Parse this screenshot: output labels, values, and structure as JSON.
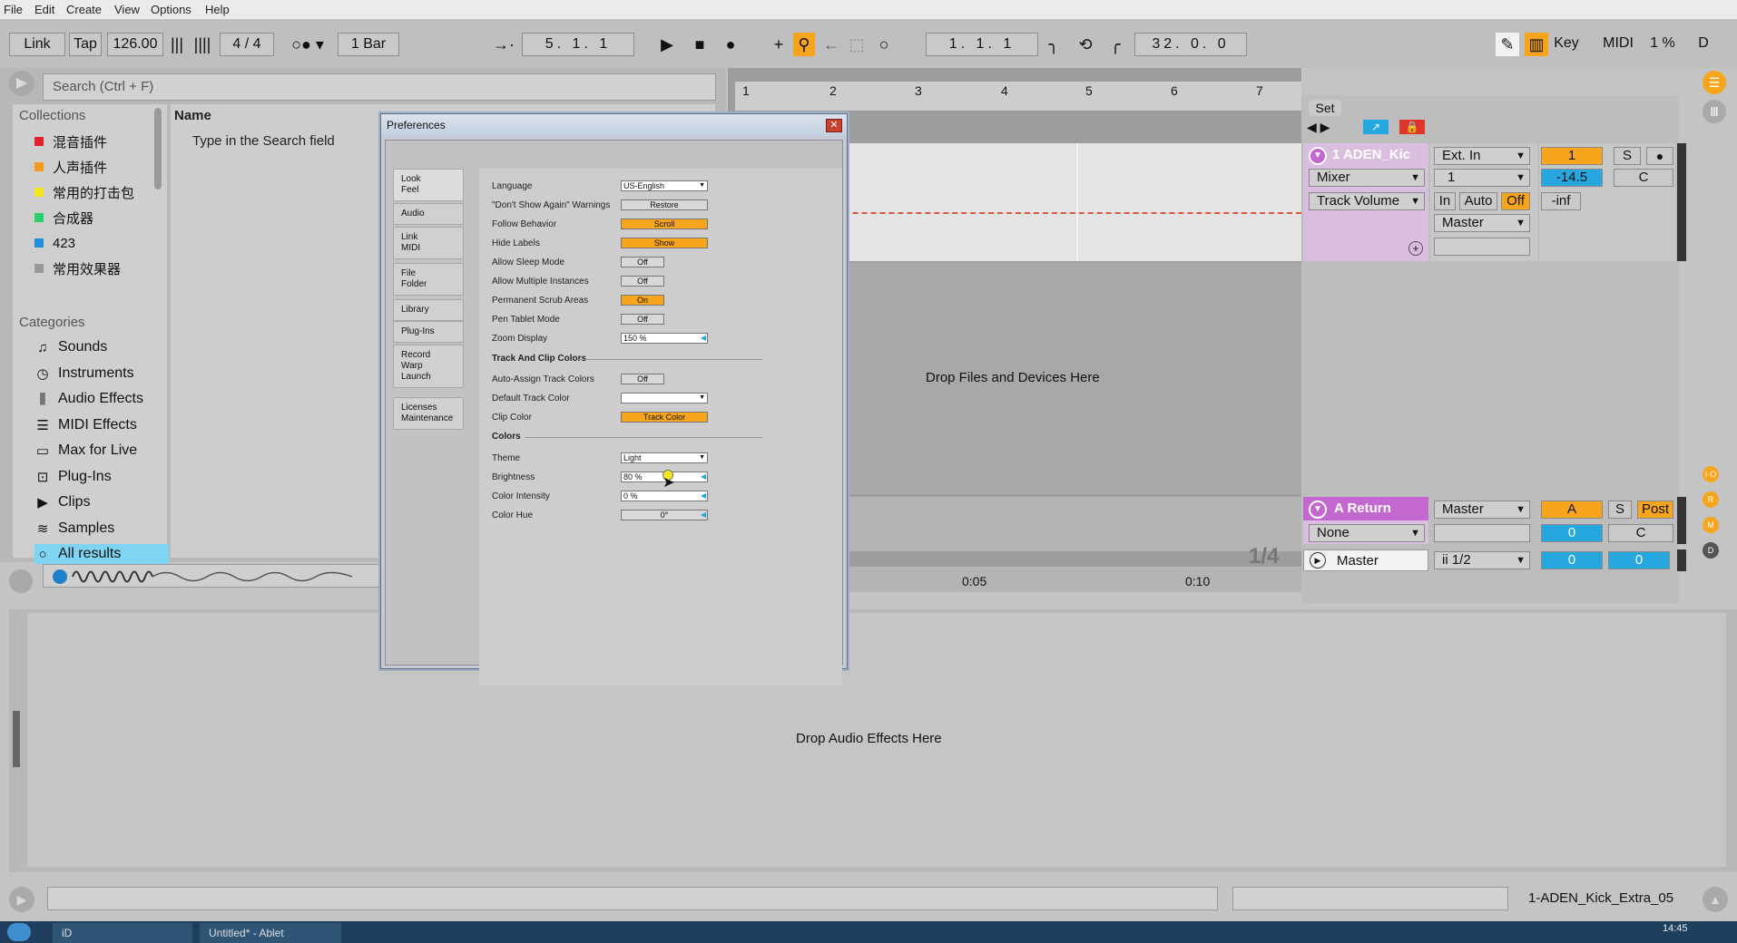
{
  "menu": [
    "File",
    "Edit",
    "Create",
    "View",
    "Options",
    "Help"
  ],
  "transport": {
    "link": "Link",
    "tap": "Tap",
    "tempo": "126.00",
    "signature": "4  /  4",
    "quantize": "1 Bar",
    "arr_position": "5.  1.  1",
    "loop_start": "1.  1.  1",
    "loop_length": "32.  0.  0",
    "key": "Key",
    "midi": "MIDI",
    "cpu": "1 %",
    "d": "D"
  },
  "browser": {
    "search_placeholder": "Search (Ctrl + F)",
    "collections_title": "Collections",
    "collections": [
      {
        "label": "混音插件",
        "color": "#e0202a"
      },
      {
        "label": "人声插件",
        "color": "#f29a1d"
      },
      {
        "label": "常用的打击包",
        "color": "#f2e51d"
      },
      {
        "label": "合成器",
        "color": "#2cd06a"
      },
      {
        "label": "423",
        "color": "#1f8fd8"
      },
      {
        "label": "常用效果器",
        "color": "#9a9a9a"
      }
    ],
    "categories_title": "Categories",
    "categories": [
      {
        "label": "Sounds",
        "icon": "note-icon"
      },
      {
        "label": "Instruments",
        "icon": "clock-icon"
      },
      {
        "label": "Audio Effects",
        "icon": "bars-icon"
      },
      {
        "label": "MIDI Effects",
        "icon": "sliders-icon"
      },
      {
        "label": "Max for Live",
        "icon": "device-icon"
      },
      {
        "label": "Plug-Ins",
        "icon": "plug-icon"
      },
      {
        "label": "Clips",
        "icon": "clip-icon"
      },
      {
        "label": "Samples",
        "icon": "wave-icon"
      },
      {
        "label": "All results",
        "icon": "search-icon"
      }
    ],
    "name_header": "Name",
    "empty_hint": "Type in the Search field"
  },
  "arrangement": {
    "ruler": [
      "1",
      "2",
      "3",
      "4",
      "5",
      "6",
      "7"
    ],
    "set_label": "Set",
    "drop_hint": "Drop Files and Devices Here",
    "time_marks": [
      "0:05",
      "0:10"
    ],
    "zoom_ratio": "1/4"
  },
  "track1": {
    "name": "1 ADEN_Kic",
    "input": "Ext. In",
    "channel": "1",
    "monitor": [
      "In",
      "Auto",
      "Off"
    ],
    "output": "Master",
    "device": "Mixer",
    "param": "Track Volume",
    "number": "1",
    "solo": "S",
    "volume": "-14.5",
    "pan": "C",
    "peak": "-inf"
  },
  "return_a": {
    "name": "A Return",
    "output": "Master",
    "device": "None",
    "letter": "A",
    "solo": "S",
    "post": "Post",
    "send": "0",
    "pan": "C"
  },
  "master": {
    "name": "Master",
    "output": "ii 1/2",
    "vol1": "0",
    "vol2": "0"
  },
  "device_view": {
    "drop_hint": "Drop Audio Effects Here"
  },
  "status": {
    "clip_name": "1-ADEN_Kick_Extra_05",
    "clock": "14:45"
  },
  "preferences": {
    "title": "Preferences",
    "tabs": [
      "Look\nFeel",
      "Audio",
      "Link\nMIDI",
      "File\nFolder",
      "Library",
      "Plug-Ins",
      "Record\nWarp\nLaunch",
      "Licenses\nMaintenance"
    ],
    "rows": [
      {
        "label": "Language",
        "value": "US-English"
      },
      {
        "label": "\"Don't Show Again\" Warnings",
        "value": "Restore"
      },
      {
        "label": "Follow Behavior",
        "value": "Scroll"
      },
      {
        "label": "Hide Labels",
        "value": "Show"
      },
      {
        "label": "Allow Sleep Mode",
        "value": "Off"
      },
      {
        "label": "Allow Multiple Instances",
        "value": "Off"
      },
      {
        "label": "Permanent Scrub Areas",
        "value": "On"
      },
      {
        "label": "Pen Tablet Mode",
        "value": "Off"
      },
      {
        "label": "Zoom Display",
        "value": "150 %"
      }
    ],
    "section_track_colors": "Track And Clip Colors",
    "track_rows": [
      {
        "label": "Auto-Assign Track Colors",
        "value": "Off"
      },
      {
        "label": "Default Track Color",
        "value": ""
      },
      {
        "label": "Clip Color",
        "value": "Track Color"
      }
    ],
    "section_colors": "Colors",
    "color_rows": [
      {
        "label": "Theme",
        "value": "Light"
      },
      {
        "label": "Brightness",
        "value": "80 %"
      },
      {
        "label": "Color Intensity",
        "value": "0 %"
      },
      {
        "label": "Color Hue",
        "value": "0°"
      }
    ]
  },
  "taskbar": {
    "app1": "iD",
    "app2": "Untitled* - Ablet"
  }
}
